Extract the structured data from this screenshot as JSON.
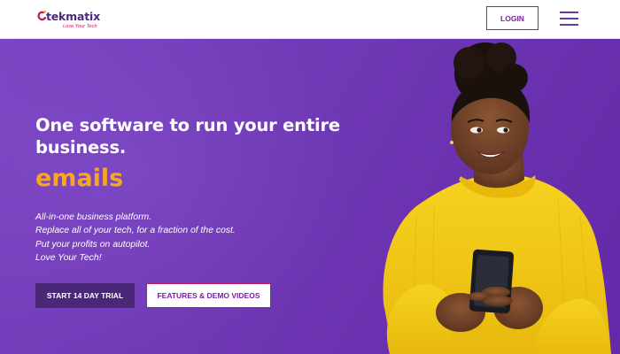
{
  "brand": {
    "name": "tekmatix",
    "tagline": "Love Your Tech"
  },
  "nav": {
    "login_label": "LOGIN",
    "menu_icon": "hamburger-menu-icon"
  },
  "hero": {
    "headline": "One software to run your entire business.",
    "rotating_word": "emails",
    "lines": [
      "All-in-one business platform.",
      "Replace all of your tech, for a fraction of the cost.",
      "Put your profits on autopilot.",
      "Love Your Tech!"
    ],
    "primary_cta": "START 14 DAY TRIAL",
    "secondary_cta": "FEATURES & DEMO VIDEOS"
  },
  "colors": {
    "hero_background": "#7240b8",
    "accent_orange": "#f5a623",
    "brand_magenta": "#c2185b",
    "brand_purple": "#4b2a7b",
    "primary_button": "#4a2878",
    "sweater_yellow": "#f2c81a"
  }
}
